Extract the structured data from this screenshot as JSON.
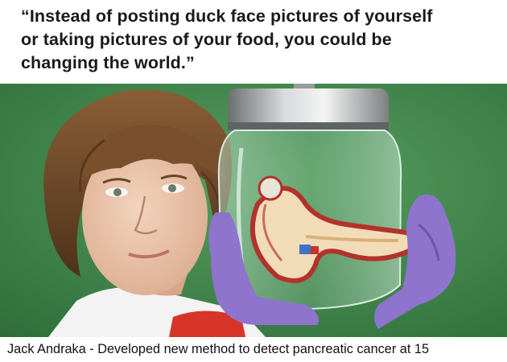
{
  "quote": {
    "line1": "“Instead of posting duck face pictures of yourself",
    "line2": "or taking pictures of your food, you could be",
    "line3": "changing the world.”"
  },
  "caption": "Jack Andraka - Developed new method to detect pancreatic cancer at 15",
  "colors": {
    "background_green": "#3f8a4b",
    "glove_purple": "#8e74cc",
    "hair_brown": "#6b4626",
    "organ_cream": "#f2dcb8",
    "organ_red": "#b3322c",
    "shirt_white": "#f4f4f4",
    "shirt_red": "#d8352a"
  }
}
